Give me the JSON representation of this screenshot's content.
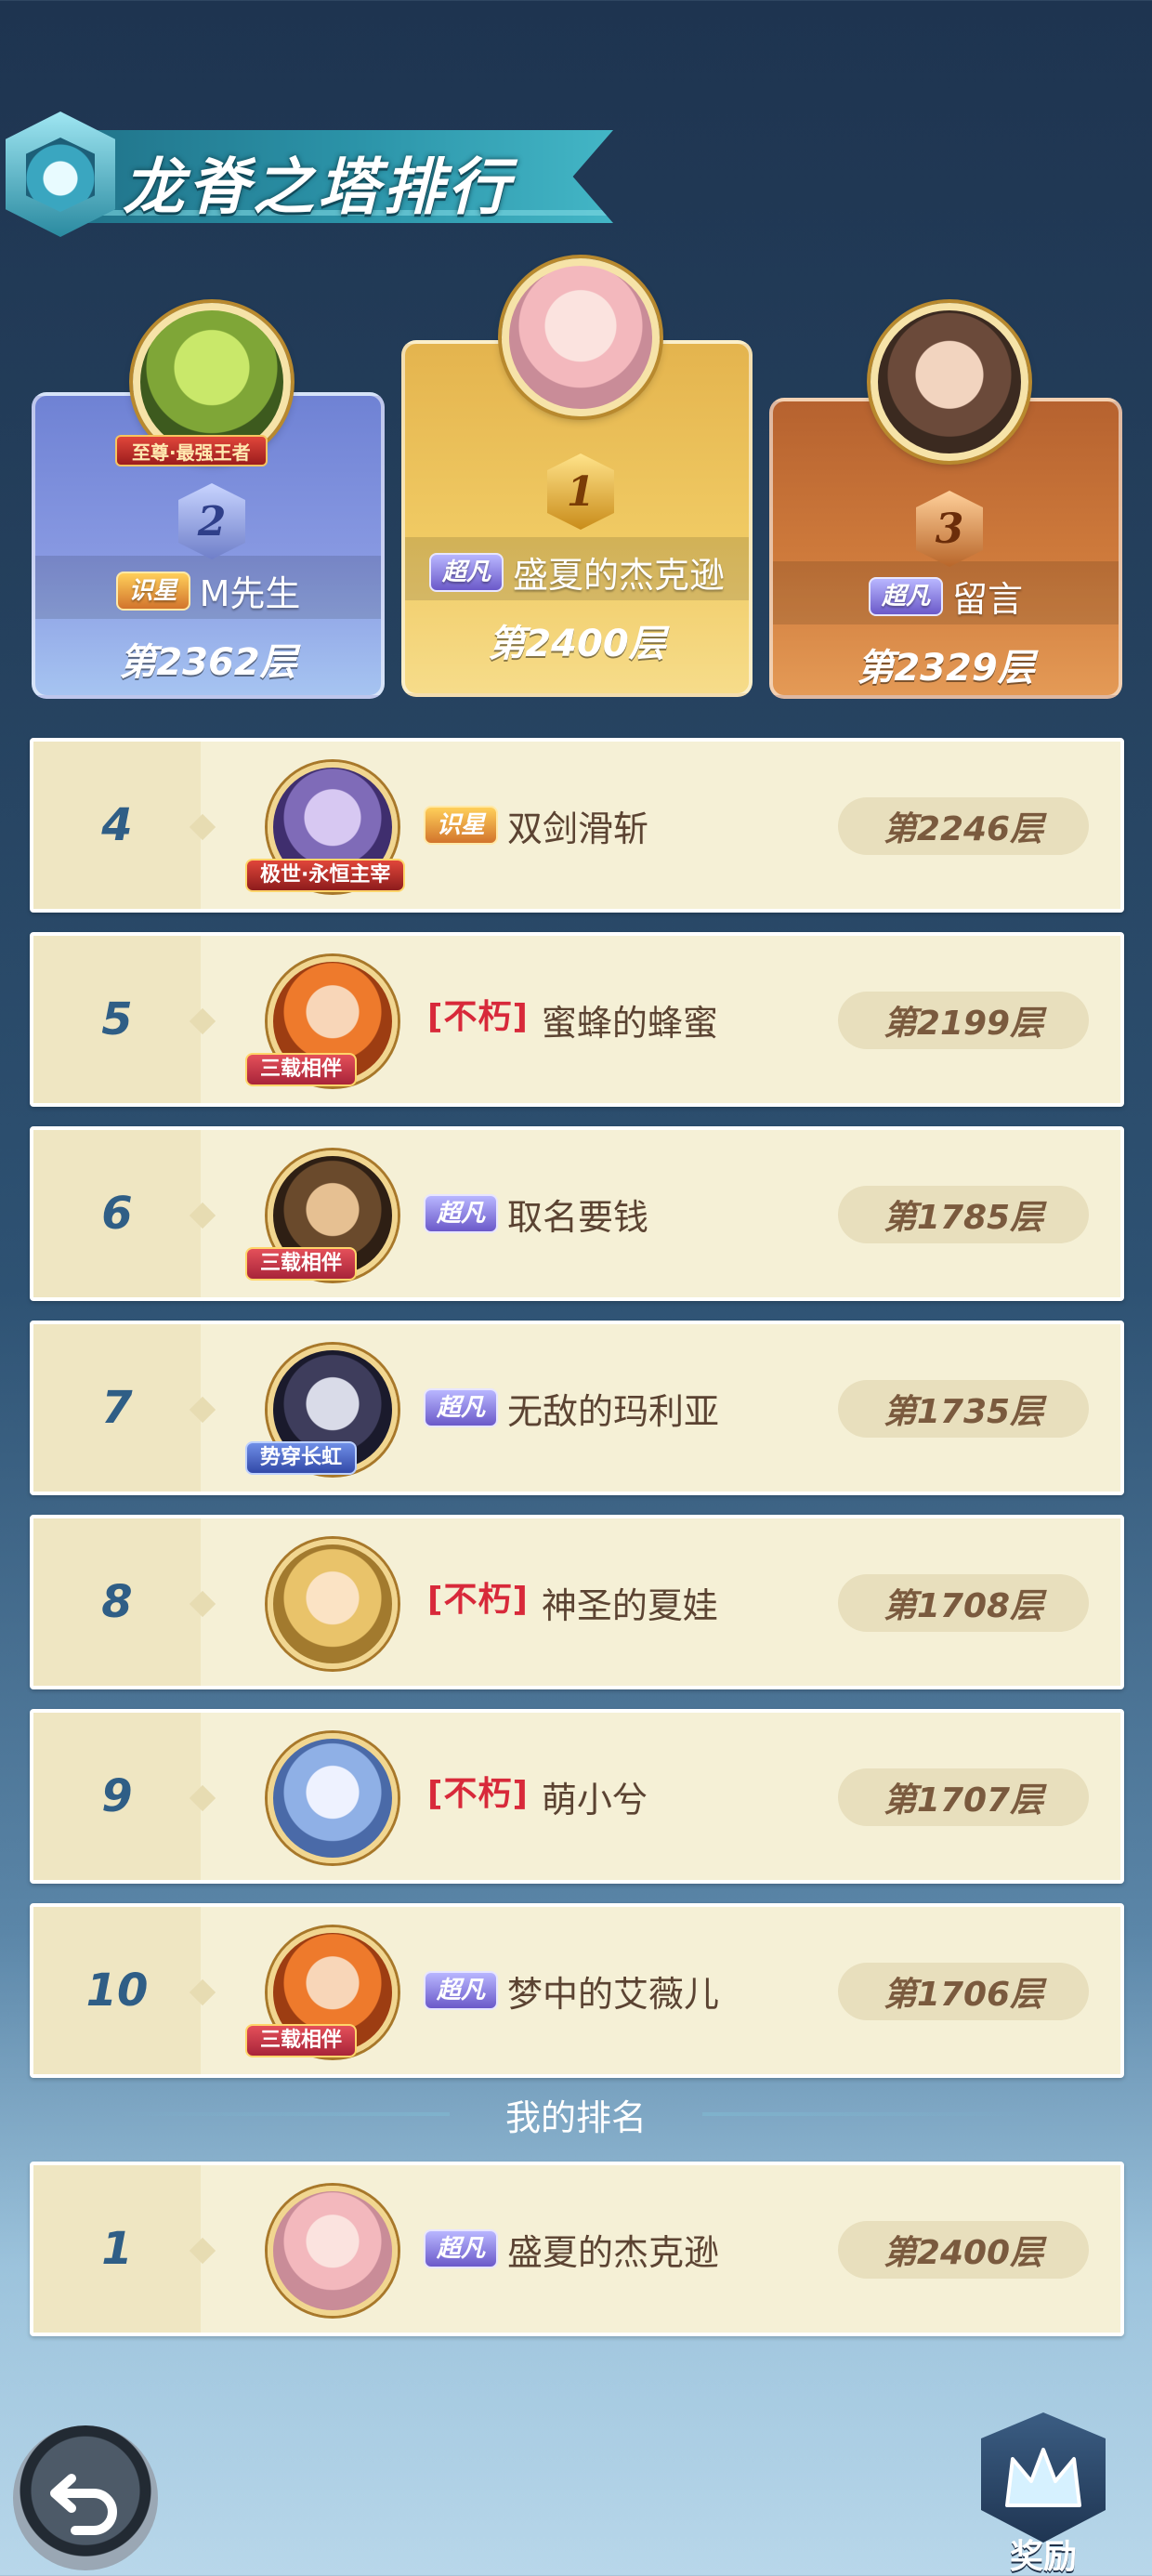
{
  "title": "龙脊之塔排行",
  "podium": [
    {
      "rank": "2",
      "frame_title": "至尊·最强王者",
      "badge": "识星",
      "name": "M先生",
      "floor": "第2362层"
    },
    {
      "rank": "1",
      "badge": "超凡",
      "name": "盛夏的杰克逊",
      "floor": "第2400层"
    },
    {
      "rank": "3",
      "badge": "超凡",
      "name": "留言",
      "floor": "第2329层"
    }
  ],
  "rows": [
    {
      "rank": "4",
      "frame": "极世·永恒主宰",
      "badge": "识星",
      "name": "双剑滑斩",
      "floor": "第2246层"
    },
    {
      "rank": "5",
      "frame": "三载相伴",
      "badge": "[不朽]",
      "name": "蜜蜂的蜂蜜",
      "floor": "第2199层"
    },
    {
      "rank": "6",
      "frame": "三载相伴",
      "badge": "超凡",
      "name": "取名要钱",
      "floor": "第1785层"
    },
    {
      "rank": "7",
      "frame": "势穿长虹",
      "badge": "超凡",
      "name": "无敌的玛利亚",
      "floor": "第1735层"
    },
    {
      "rank": "8",
      "frame": "",
      "badge": "[不朽]",
      "name": "神圣的夏娃",
      "floor": "第1708层"
    },
    {
      "rank": "9",
      "frame": "",
      "badge": "[不朽]",
      "name": "萌小兮",
      "floor": "第1707层"
    },
    {
      "rank": "10",
      "frame": "三载相伴",
      "badge": "超凡",
      "name": "梦中的艾薇儿",
      "floor": "第1706层"
    }
  ],
  "my_rank_label": "我的排名",
  "my_rank": {
    "rank": "1",
    "badge": "超凡",
    "name": "盛夏的杰克逊",
    "floor": "第2400层"
  },
  "buttons": {
    "reward_label": "奖励"
  },
  "icons": {
    "title_emblem": "tower-emblem-icon",
    "back": "back-arrow-icon",
    "reward": "crown-icon"
  },
  "colors": {
    "rank_number": "#2f5e86",
    "row_background": "#f5f0d6",
    "floor_text": "#7a5a3e",
    "buxiu_badge": "#d8293a",
    "chaofan_badge": "#6b59c9"
  }
}
